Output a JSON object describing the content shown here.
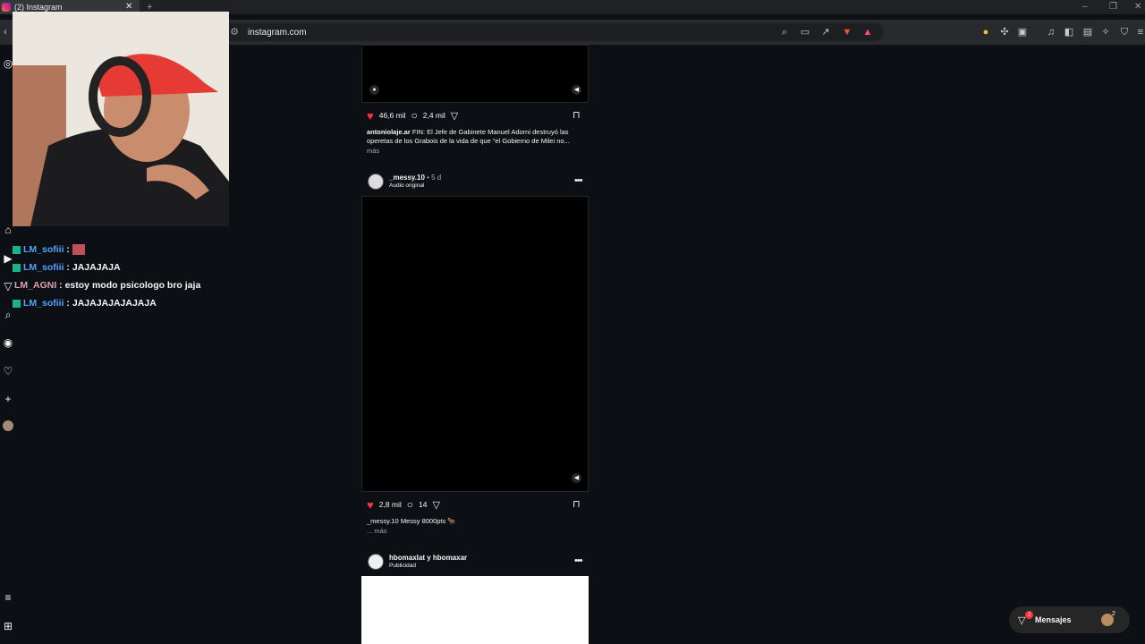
{
  "browser": {
    "tab_title": "(2) Instagram",
    "tab_close": "✕",
    "new_tab": "+",
    "url": "instagram.com",
    "window_controls": [
      "–",
      "❐",
      "✕"
    ]
  },
  "stream": {
    "chat": [
      {
        "user": "LM_sofiii",
        "sep": " : ",
        "text": "",
        "emote": true
      },
      {
        "user": "LM_sofiii",
        "sep": " : ",
        "text": "JAJAJAJA"
      },
      {
        "user": "LM_AGNI",
        "sep": " : ",
        "text": "estoy modo psicologo bro jaja"
      },
      {
        "user": "LM_sofiii",
        "sep": " : ",
        "text": "JAJAJAJAJAJAJA"
      }
    ],
    "colors": {
      "user": "#4da3ff",
      "badge": "#19b38a"
    }
  },
  "feed": {
    "post1": {
      "likes": "46,6 mil",
      "comments": "2,4 mil",
      "caption_user": "antoniolaje.ar",
      "caption_text": "FIN: El Jefe de Gabinete Manuel Adorni destruyó las operetas de los Grabois de la vida de que “el Gobierno de Milei no...",
      "more": "más"
    },
    "post2": {
      "user": "_messy.10",
      "time": " • 5 d",
      "audio": "Audio original",
      "likes": "2,8 mil",
      "comments": "14",
      "caption_user": "_messy.10",
      "caption_text": "Messy 8000pts 🐂",
      "more": "... más",
      "options": "•••"
    },
    "post3": {
      "user": "hbomaxlat y hbomaxar",
      "sub": "Publicidad",
      "options": "•••"
    }
  },
  "messages": {
    "label": "Mensajes",
    "badge": "2",
    "avatar_badge": "2"
  },
  "colors": {
    "accent_like": "#ff3040",
    "background": "#0c1014"
  }
}
